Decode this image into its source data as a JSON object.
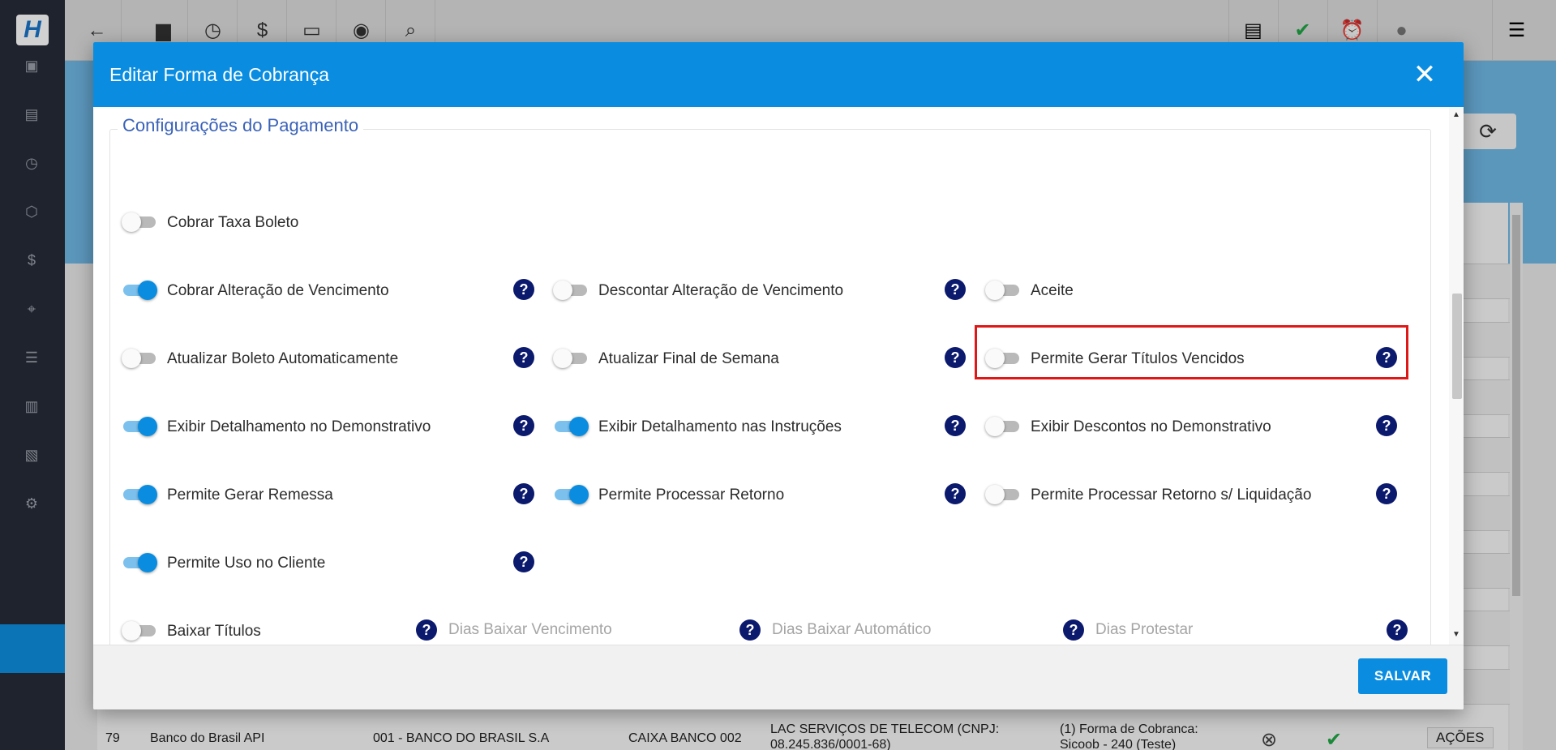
{
  "app": {
    "logo_text": "H",
    "bg_table_row": {
      "id": "79",
      "name": "Banco do Brasil API",
      "bank": "001 - BANCO DO BRASIL S.A",
      "account": "CAIXA BANCO 002",
      "company": "LAC SERVIÇOS DE TELECOM (CNPJ: 08.245.836/0001-68)",
      "forma": "(1) Forma de Cobranca: Sicoob - 240 (Teste)",
      "action_label": "AÇÕES"
    }
  },
  "modal": {
    "title": "Editar Forma de Cobrança",
    "section_title": "Configurações do Pagamento",
    "options": [
      {
        "label": "Cobrar Taxa Boleto",
        "enabled": false
      },
      {
        "label": "Cobrar Alteração de Vencimento",
        "enabled": true
      },
      {
        "label": "Descontar Alteração de Vencimento",
        "enabled": false
      },
      {
        "label": "Aceite",
        "enabled": false
      },
      {
        "label": "Atualizar Boleto Automaticamente",
        "enabled": false
      },
      {
        "label": "Atualizar Final de Semana",
        "enabled": false
      },
      {
        "label": "Permite Gerar Títulos Vencidos",
        "enabled": false
      },
      {
        "label": "Exibir Detalhamento no Demonstrativo",
        "enabled": true
      },
      {
        "label": "Exibir Detalhamento nas Instruções",
        "enabled": true
      },
      {
        "label": "Exibir Descontos no Demonstrativo",
        "enabled": false
      },
      {
        "label": "Permite Gerar Remessa",
        "enabled": true
      },
      {
        "label": "Permite Processar Retorno",
        "enabled": true
      },
      {
        "label": "Permite Processar Retorno s/ Liquidação",
        "enabled": false
      },
      {
        "label": "Permite Uso no Cliente",
        "enabled": true
      },
      {
        "label": "Baixar Títulos",
        "enabled": false
      }
    ],
    "fields": {
      "dias_baixar_vencimento": {
        "placeholder": "Dias Baixar Vencimento",
        "value": ""
      },
      "dias_baixar_automatico": {
        "placeholder": "Dias Baixar Automático",
        "value": ""
      },
      "dias_protestar": {
        "placeholder": "Dias Protestar",
        "value": ""
      }
    },
    "help_glyph": "?",
    "close_glyph": "✕",
    "save_label": "SALVAR"
  },
  "colors": {
    "primary": "#0a8de0",
    "help_icon": "#0c1a6e",
    "highlight": "#e01717"
  }
}
